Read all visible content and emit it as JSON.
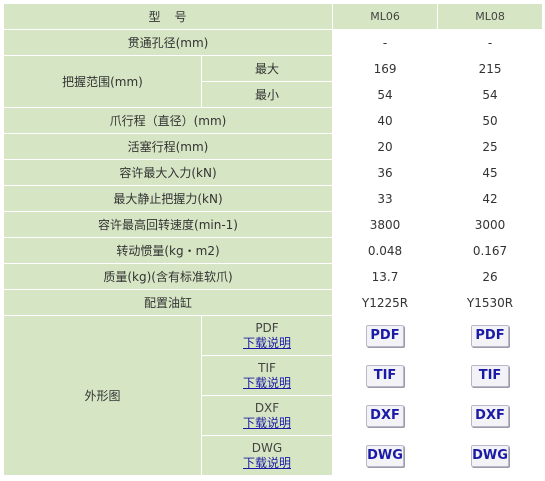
{
  "header": {
    "model_label": "型　号",
    "ml06": "ML06",
    "ml08": "ML08"
  },
  "rows": {
    "bore": {
      "label": "贯通孔径(mm)",
      "ml06": "-",
      "ml08": "-"
    },
    "grip_range": {
      "label": "把握范围(mm)",
      "max_label": "最大",
      "max_ml06": "169",
      "max_ml08": "215",
      "min_label": "最小",
      "min_ml06": "54",
      "min_ml08": "54"
    },
    "jaw_stroke": {
      "label": "爪行程（直径）(mm)",
      "ml06": "40",
      "ml08": "50"
    },
    "piston_stroke": {
      "label": "活塞行程(mm)",
      "ml06": "20",
      "ml08": "25"
    },
    "max_input": {
      "label": "容许最大入力(kN)",
      "ml06": "36",
      "ml08": "45"
    },
    "static_grip": {
      "label": "最大静止把握力(kN)",
      "ml06": "33",
      "ml08": "42"
    },
    "max_speed": {
      "label": "容许最高回转速度(min-1)",
      "ml06": "3800",
      "ml08": "3000"
    },
    "inertia": {
      "label": "转动惯量(kg・m2)",
      "ml06": "0.048",
      "ml08": "0.167"
    },
    "mass": {
      "label": "质量(kg)(含有标准软爪)",
      "ml06": "13.7",
      "ml08": "26"
    },
    "cylinder": {
      "label": "配置油缸",
      "ml06": "Y1225R",
      "ml08": "Y1530R"
    }
  },
  "outline": {
    "label": "外形图",
    "download_text": "下载说明",
    "formats": [
      {
        "name": "PDF",
        "button": "PDF"
      },
      {
        "name": "TIF",
        "button": "TIF"
      },
      {
        "name": "DXF",
        "button": "DXF"
      },
      {
        "name": "DWG",
        "button": "DWG"
      }
    ]
  }
}
